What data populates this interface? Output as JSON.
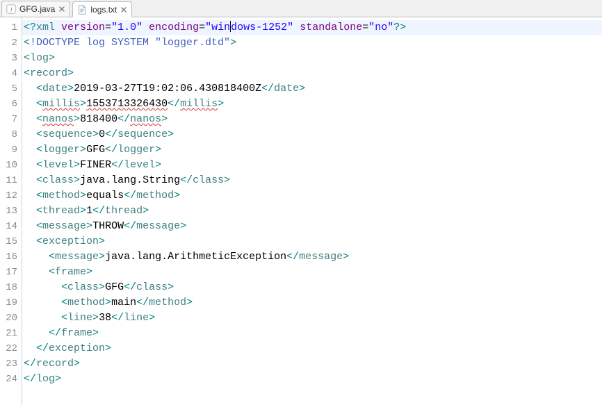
{
  "tabs": [
    {
      "label": "GFG.java",
      "active": false,
      "icon": "java"
    },
    {
      "label": "logs.txt",
      "active": true,
      "icon": "text"
    }
  ],
  "first_line_number": 1,
  "highlighted_line": 1,
  "caret": {
    "line": 1,
    "after_text": "win"
  },
  "code_lines": [
    {
      "indent": "",
      "kind": "xmldecl",
      "attrs": [
        {
          "name": "version",
          "value": "1.0"
        },
        {
          "name": "encoding",
          "value": "windows-1252"
        },
        {
          "name": "standalone",
          "value": "no"
        }
      ]
    },
    {
      "indent": "",
      "kind": "doctype",
      "text": "!DOCTYPE log SYSTEM \"logger.dtd\""
    },
    {
      "indent": "",
      "kind": "open",
      "tag": "log"
    },
    {
      "indent": "",
      "kind": "open",
      "tag": "record"
    },
    {
      "indent": "  ",
      "kind": "elem",
      "tag": "date",
      "text": "2019-03-27T19:02:06.430818400Z"
    },
    {
      "indent": "  ",
      "kind": "elem",
      "tag": "millis",
      "text": "1553713326430",
      "wavy_tag": true,
      "wavy_text": true
    },
    {
      "indent": "  ",
      "kind": "elem",
      "tag": "nanos",
      "text": "818400",
      "wavy_tag": true
    },
    {
      "indent": "  ",
      "kind": "elem",
      "tag": "sequence",
      "text": "0"
    },
    {
      "indent": "  ",
      "kind": "elem",
      "tag": "logger",
      "text": "GFG"
    },
    {
      "indent": "  ",
      "kind": "elem",
      "tag": "level",
      "text": "FINER"
    },
    {
      "indent": "  ",
      "kind": "elem",
      "tag": "class",
      "text": "java.lang.String"
    },
    {
      "indent": "  ",
      "kind": "elem",
      "tag": "method",
      "text": "equals"
    },
    {
      "indent": "  ",
      "kind": "elem",
      "tag": "thread",
      "text": "1"
    },
    {
      "indent": "  ",
      "kind": "elem",
      "tag": "message",
      "text": "THROW"
    },
    {
      "indent": "  ",
      "kind": "open",
      "tag": "exception"
    },
    {
      "indent": "    ",
      "kind": "elem",
      "tag": "message",
      "text": "java.lang.ArithmeticException"
    },
    {
      "indent": "    ",
      "kind": "open",
      "tag": "frame"
    },
    {
      "indent": "      ",
      "kind": "elem",
      "tag": "class",
      "text": "GFG"
    },
    {
      "indent": "      ",
      "kind": "elem",
      "tag": "method",
      "text": "main"
    },
    {
      "indent": "      ",
      "kind": "elem",
      "tag": "line",
      "text": "38"
    },
    {
      "indent": "    ",
      "kind": "close",
      "tag": "frame"
    },
    {
      "indent": "  ",
      "kind": "close",
      "tag": "exception"
    },
    {
      "indent": "",
      "kind": "close",
      "tag": "record"
    },
    {
      "indent": "",
      "kind": "close",
      "tag": "log"
    }
  ]
}
